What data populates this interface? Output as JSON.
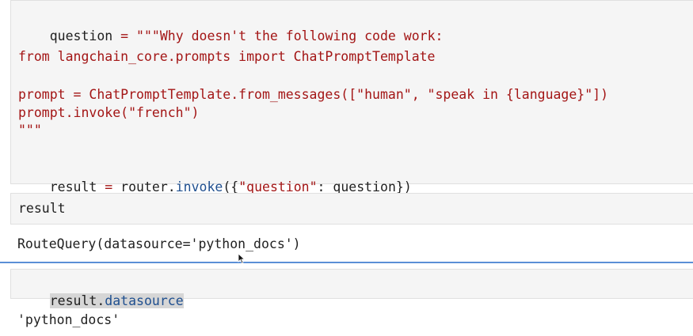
{
  "cells": {
    "cell1": {
      "line1_a": "question",
      "line1_b": " = ",
      "line1_c": "\"\"\"Why doesn't the following code work:",
      "line2": "from langchain_core.prompts import ChatPromptTemplate",
      "line3": "prompt = ChatPromptTemplate.from_messages([\"human\", \"speak in {language}\"])",
      "line4": "prompt.invoke(\"french\")",
      "line5": "\"\"\"",
      "line6_a": "result",
      "line6_b": " = ",
      "line6_c": "router.",
      "line6_d": "invoke",
      "line6_e": "({",
      "line6_f": "\"question\"",
      "line6_g": ": question})"
    },
    "cell2": {
      "input": "result",
      "output": "RouteQuery(datasource='python_docs')"
    },
    "cell3": {
      "input_a": "result.",
      "input_b": "datasource",
      "output": "'python_docs'"
    }
  }
}
